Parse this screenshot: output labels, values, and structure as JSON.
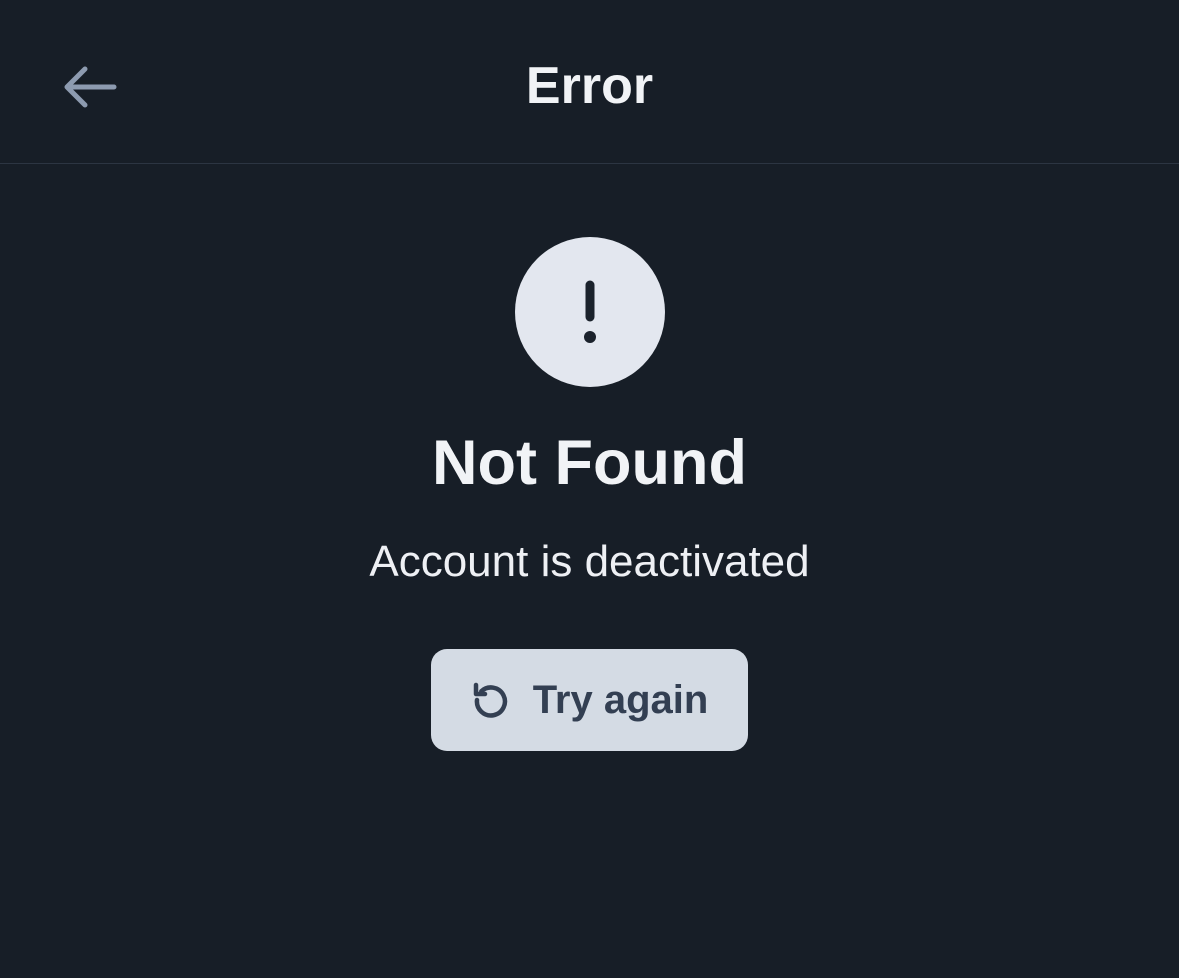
{
  "header": {
    "title": "Error",
    "back_icon": "arrow-left-icon"
  },
  "error": {
    "icon": "exclamation-icon",
    "heading": "Not Found",
    "message": "Account is deactivated"
  },
  "retry_button": {
    "label": "Try again",
    "icon": "refresh-icon"
  },
  "colors": {
    "background": "#171e27",
    "text": "#f1f3f6",
    "icon_circle": "#e3e7ef",
    "button_background": "#d4dbe4",
    "button_text": "#333f52",
    "back_arrow": "#8d9bb0"
  }
}
